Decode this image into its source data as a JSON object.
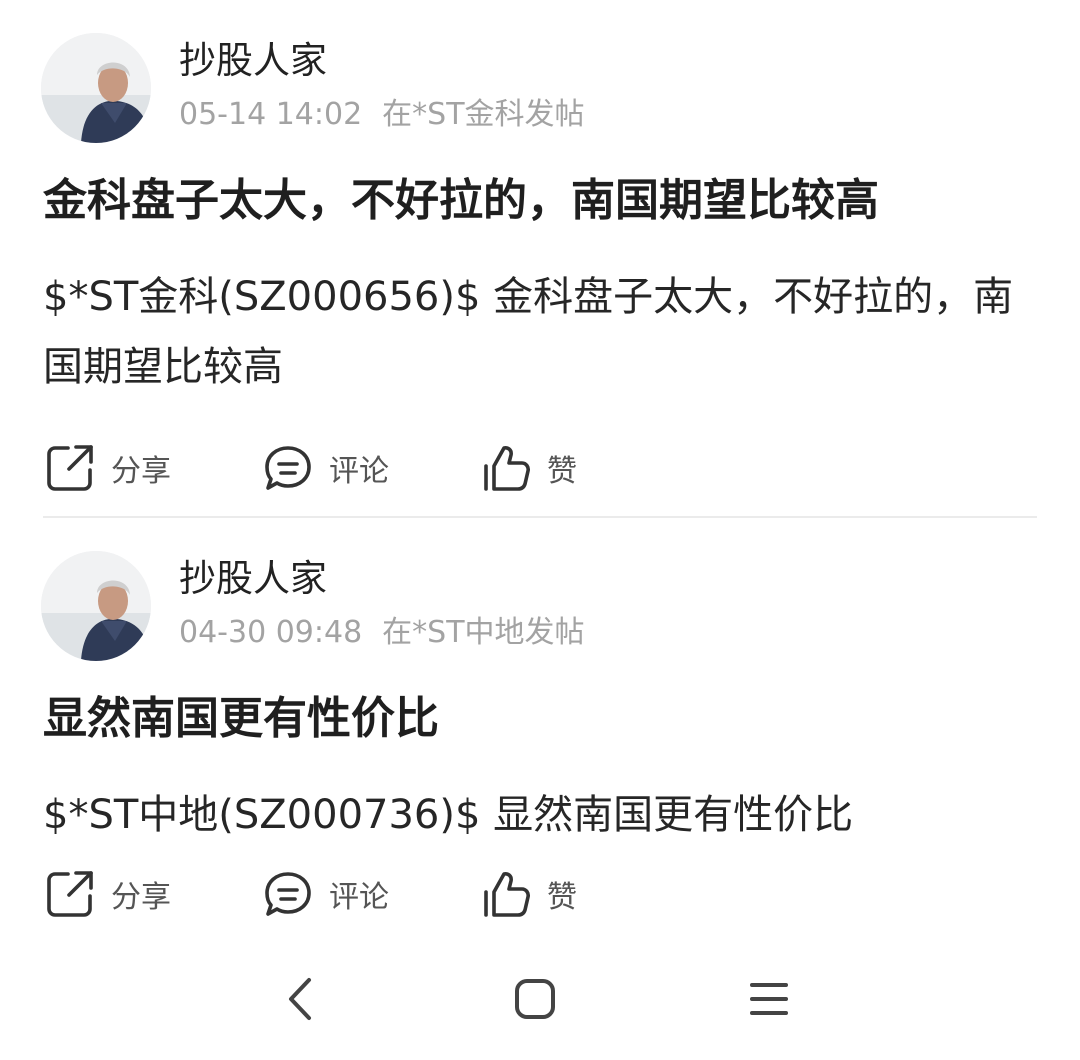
{
  "posts": [
    {
      "author": "抄股人家",
      "time": "05-14 14:02",
      "source": "在*ST金科发帖",
      "title": "金科盘子太大，不好拉的，南国期望比较高",
      "body": "$*ST金科(SZ000656)$ 金科盘子太大，不好拉的，南国期望比较高",
      "actions": {
        "share": "分享",
        "comment": "评论",
        "like": "赞"
      }
    },
    {
      "author": "抄股人家",
      "time": "04-30 09:48",
      "source": "在*ST中地发帖",
      "title": "显然南国更有性价比",
      "body": "$*ST中地(SZ000736)$ 显然南国更有性价比",
      "actions": {
        "share": "分享",
        "comment": "评论",
        "like": "赞"
      }
    }
  ],
  "icons": {
    "share": "share-icon",
    "comment": "comment-icon",
    "like": "thumbs-up-icon",
    "nav_back": "back-icon",
    "nav_home": "home-icon",
    "nav_menu": "menu-icon"
  },
  "colors": {
    "text_primary": "#222222",
    "text_meta": "#a3a3a3",
    "icon": "#333333",
    "divider": "#ebebeb"
  }
}
